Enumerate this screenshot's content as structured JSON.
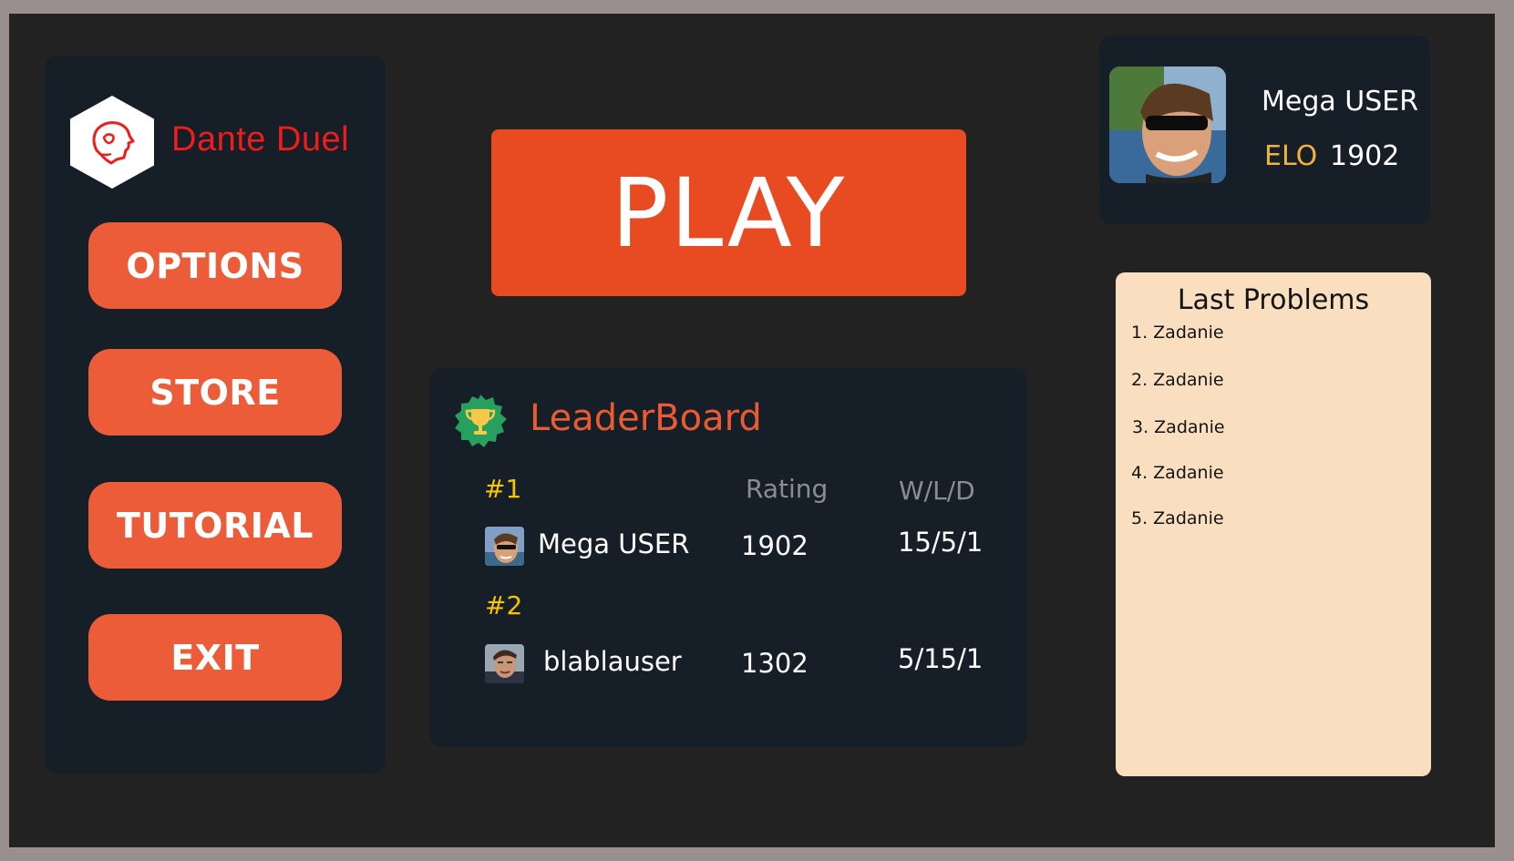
{
  "app": {
    "brand": "Dante Duel",
    "accent": "#ec5c39",
    "brand_color": "#ef1c1c"
  },
  "menu": {
    "options": "OPTIONS",
    "store": "STORE",
    "tutorial": "TUTORIAL",
    "exit": "EXIT"
  },
  "play": {
    "label": "PLAY"
  },
  "leaderboard": {
    "title": "LeaderBoard",
    "icon": "trophy-icon",
    "columns": {
      "rating": "Rating",
      "wld": "W/L/D"
    },
    "rows": [
      {
        "rank": "#1",
        "name": "Mega USER",
        "rating": "1902",
        "wld": "15/5/1"
      },
      {
        "rank": "#2",
        "name": "blablauser",
        "rating": "1302",
        "wld": "5/15/1"
      }
    ]
  },
  "profile": {
    "name": "Mega USER",
    "elo_label": "ELO",
    "elo": "1902"
  },
  "last_problems": {
    "title": "Last Problems",
    "items": [
      "1. Zadanie",
      "2. Zadanie",
      "3. Zadanie",
      "4. Zadanie",
      "5. Zadanie"
    ]
  }
}
